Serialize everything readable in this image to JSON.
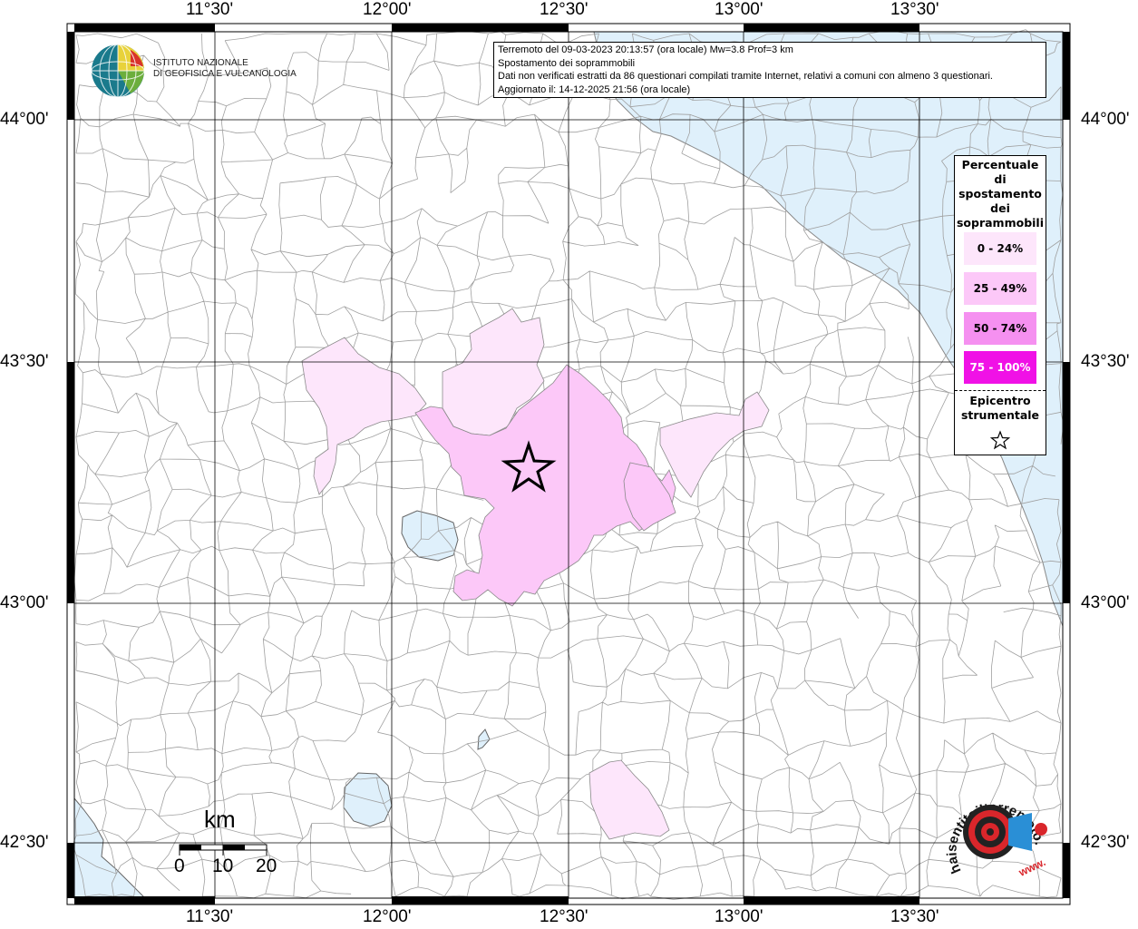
{
  "info": {
    "line1": "Terremoto del 09-03-2023 20:13:57 (ora locale) Mw=3.8 Prof=3 km",
    "line2": "Spostamento dei soprammobili",
    "line3": "Dati non verificati estratti da 86 questionari compilati tramite Internet, relativi a comuni con almeno 3 questionari.",
    "line4": "Aggiornato il: 14-12-2025 21:56 (ora locale)"
  },
  "axes": {
    "lon_labels": [
      "11°30'",
      "12°00'",
      "12°30'",
      "13°00'",
      "13°30'"
    ],
    "lat_labels": [
      "44°00'",
      "43°30'",
      "43°00'",
      "42°30'"
    ]
  },
  "legend": {
    "title": "Percentuale\ndi\nspostamento\ndei\nsoprammobili",
    "classes": [
      {
        "label": "0 - 24%",
        "color": "#fde6fb"
      },
      {
        "label": "25 - 49%",
        "color": "#fcc8f8"
      },
      {
        "label": "50 - 74%",
        "color": "#f590f0"
      },
      {
        "label": "75 - 100%",
        "color": "#f011e6"
      }
    ],
    "epicenter_label": "Epicentro strumentale",
    "epicenter_icon": "star-icon"
  },
  "scale": {
    "unit": "km",
    "labels": [
      "0",
      "10",
      "20"
    ]
  },
  "logos": {
    "ingv_line1": "ISTITUTO NAZIONALE",
    "ingv_line2": "DI GEOFISICA E VULCANOLOGIA",
    "hst_text": "haisentitoilterremoto.it",
    "hst_www": "www."
  },
  "colors": {
    "sea": "#dff0fb",
    "land": "#ffffff",
    "borders": "#9a9a9a",
    "grid": "#000000"
  }
}
